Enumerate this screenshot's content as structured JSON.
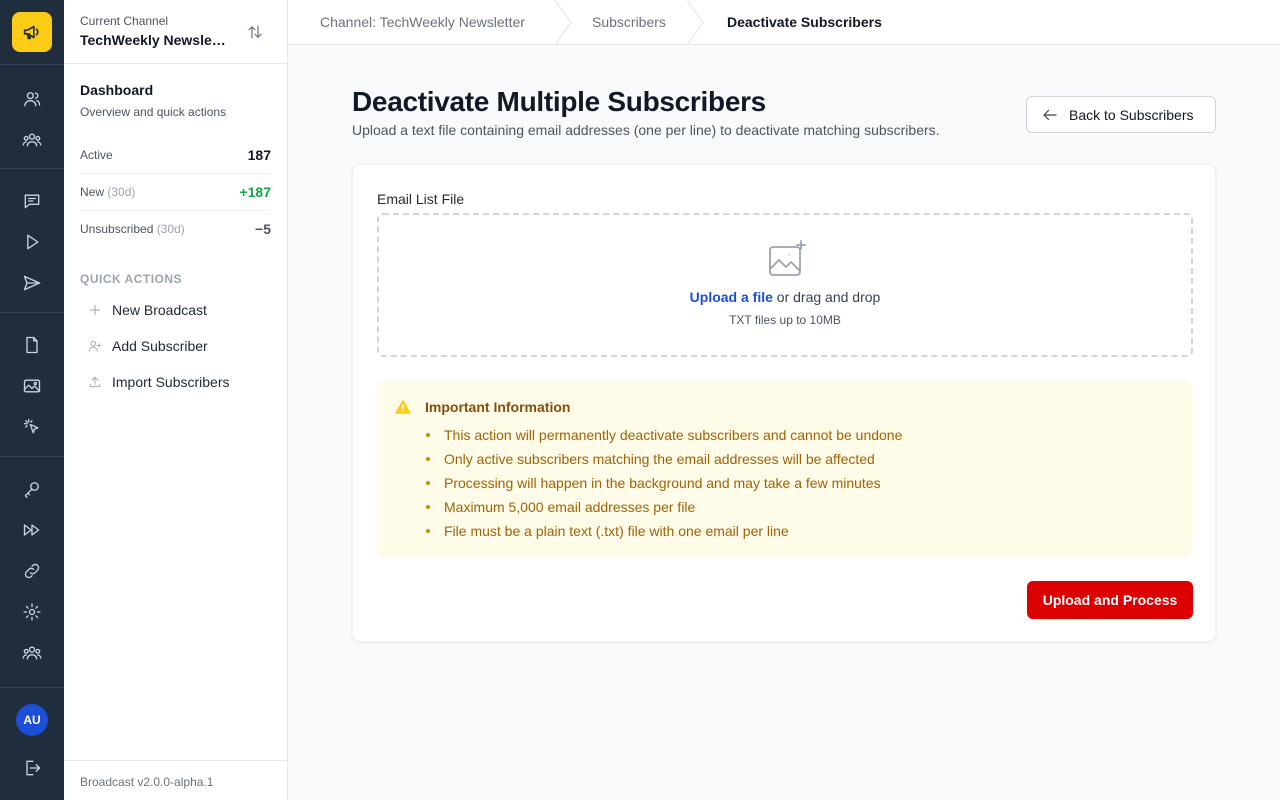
{
  "sidebar": {
    "current_channel_label": "Current Channel",
    "channel_name": "TechWeekly Newsletter",
    "dashboard_title": "Dashboard",
    "dashboard_subtitle": "Overview and quick actions",
    "stats": [
      {
        "label": "Active",
        "period": "",
        "value": "187",
        "color": "#111827"
      },
      {
        "label": "New",
        "period": "(30d)",
        "value": "+187",
        "color": "#16a34a"
      },
      {
        "label": "Unsubscribed",
        "period": "(30d)",
        "value": "−5",
        "color": "#4b5563"
      }
    ],
    "quick_actions_title": "QUICK ACTIONS",
    "quick_actions": [
      {
        "label": "New Broadcast",
        "icon": "plus-icon"
      },
      {
        "label": "Add Subscriber",
        "icon": "user-plus-icon"
      },
      {
        "label": "Import Subscribers",
        "icon": "upload-icon"
      }
    ],
    "version": "Broadcast v2.0.0-alpha.1"
  },
  "rail": {
    "logo_icon": "megaphone-icon",
    "avatar_initials": "AU",
    "icons": [
      "users-icon",
      "group-icon",
      "chat-icon",
      "play-icon",
      "send-icon",
      "document-icon",
      "image-icon",
      "pointer-icon",
      "key-icon",
      "fast-forward-icon",
      "link-icon",
      "gear-icon",
      "team-icon",
      "logout-icon"
    ]
  },
  "breadcrumb": {
    "items": [
      "Channel: TechWeekly Newsletter",
      "Subscribers",
      "Deactivate Subscribers"
    ]
  },
  "main": {
    "title": "Deactivate Multiple Subscribers",
    "subtitle": "Upload a text file containing email addresses (one per line) to deactivate matching subscribers.",
    "back_button": "Back to Subscribers",
    "field_label": "Email List File",
    "upload_link": "Upload a file",
    "upload_rest": " or drag and drop",
    "upload_hint": "TXT files up to 10MB",
    "alert_title": "Important Information",
    "alert_items": [
      "This action will permanently deactivate subscribers and cannot be undone",
      "Only active subscribers matching the email addresses will be affected",
      "Processing will happen in the background and may take a few minutes",
      "Maximum 5,000 email addresses per file",
      "File must be a plain text (.txt) file with one email per line"
    ],
    "submit_button": "Upload and Process"
  },
  "colors": {
    "rail_bg": "#1f2d3d",
    "logo_bg": "#facc15",
    "accent_blue": "#1d4ed8",
    "danger": "#dc0000",
    "alert_bg": "#fefce8"
  }
}
